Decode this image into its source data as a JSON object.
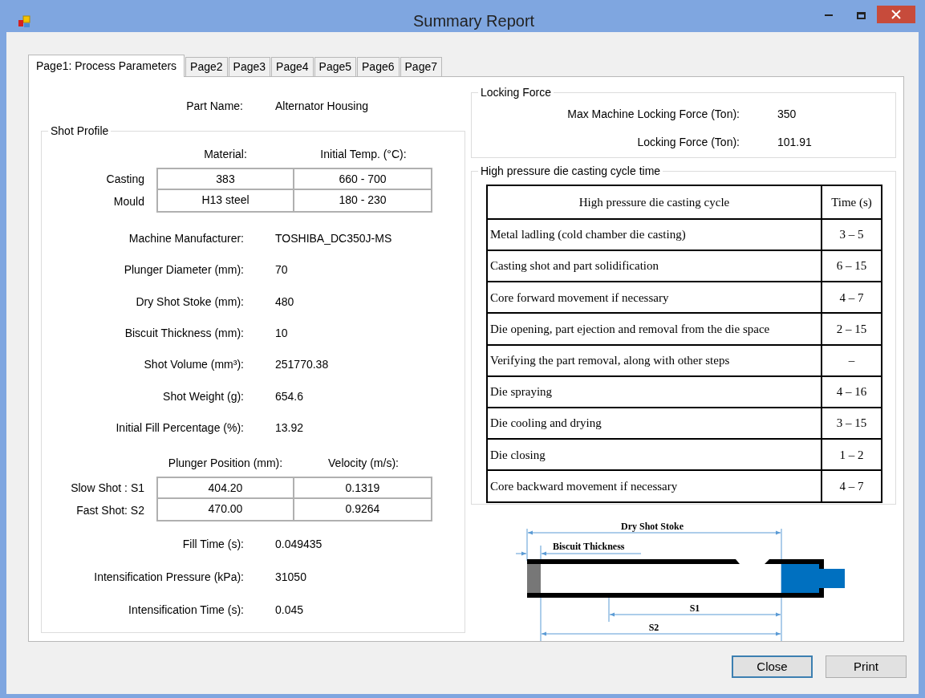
{
  "window": {
    "title": "Summary Report"
  },
  "tabs": [
    {
      "label": "Page1: Process Parameters",
      "selected": true
    },
    {
      "label": "Page2",
      "selected": false
    },
    {
      "label": "Page3",
      "selected": false
    },
    {
      "label": "Page4",
      "selected": false
    },
    {
      "label": "Page5",
      "selected": false
    },
    {
      "label": "Page6",
      "selected": false
    },
    {
      "label": "Page7",
      "selected": false
    }
  ],
  "part_name": {
    "label": "Part Name:",
    "value": "Alternator Housing"
  },
  "shot_profile": {
    "title": "Shot Profile",
    "material_table": {
      "columns": [
        "Material:",
        "Initial Temp. (°C):"
      ],
      "rows": [
        {
          "label": "Casting",
          "cells": [
            "383",
            "660 - 700"
          ]
        },
        {
          "label": "Mould",
          "cells": [
            "H13 steel",
            "180 - 230"
          ]
        }
      ]
    },
    "fields": [
      {
        "label": "Machine Manufacturer:",
        "value": "TOSHIBA_DC350J-MS"
      },
      {
        "label": "Plunger Diameter (mm):",
        "value": "70"
      },
      {
        "label": "Dry Shot Stoke (mm):",
        "value": "480"
      },
      {
        "label": "Biscuit Thickness (mm):",
        "value": "10"
      },
      {
        "label": "Shot Volume (mm³):",
        "value": "251770.38"
      },
      {
        "label": "Shot Weight (g):",
        "value": "654.6"
      },
      {
        "label": "Initial Fill Percentage (%):",
        "value": "13.92"
      }
    ],
    "shot_table": {
      "columns": [
        "Plunger Position (mm):",
        "Velocity (m/s):"
      ],
      "rows": [
        {
          "label": "Slow Shot : S1",
          "cells": [
            "404.20",
            "0.1319"
          ]
        },
        {
          "label": "Fast Shot: S2",
          "cells": [
            "470.00",
            "0.9264"
          ]
        }
      ]
    },
    "fields_after": [
      {
        "label": "Fill Time (s):",
        "value": "0.049435"
      },
      {
        "label": "Intensification Pressure (kPa):",
        "value": "31050"
      },
      {
        "label": "Intensification Time (s):",
        "value": "0.045"
      }
    ]
  },
  "locking_force": {
    "title": "Locking Force",
    "fields": [
      {
        "label": "Max Machine Locking Force (Ton):",
        "value": "350"
      },
      {
        "label": "Locking Force (Ton):",
        "value": "101.91"
      }
    ]
  },
  "cycle_time": {
    "title": "High pressure die casting cycle time",
    "table": {
      "columns": [
        "High pressure die casting cycle",
        "Time (s)"
      ],
      "rows": [
        [
          "Metal ladling (cold chamber die casting)",
          "3 – 5"
        ],
        [
          "Casting shot and part solidification",
          "6 – 15"
        ],
        [
          "Core forward movement if necessary",
          "4 – 7"
        ],
        [
          "Die opening, part ejection and removal from the die space",
          "2 – 15"
        ],
        [
          "Verifying the part removal, along with other steps",
          "–"
        ],
        [
          "Die spraying",
          "4 – 16"
        ],
        [
          "Die cooling and drying",
          "3 – 15"
        ],
        [
          "Die closing",
          "1 – 2"
        ],
        [
          "Core backward movement if necessary",
          "4 – 7"
        ]
      ]
    }
  },
  "diagram": {
    "dry_shot_stoke": "Dry Shot Stoke",
    "biscuit_thickness": "Biscuit Thickness",
    "s1": "S1",
    "s2": "S2"
  },
  "buttons": [
    {
      "label": "Close",
      "focused": true
    },
    {
      "label": "Print",
      "focused": false
    }
  ]
}
